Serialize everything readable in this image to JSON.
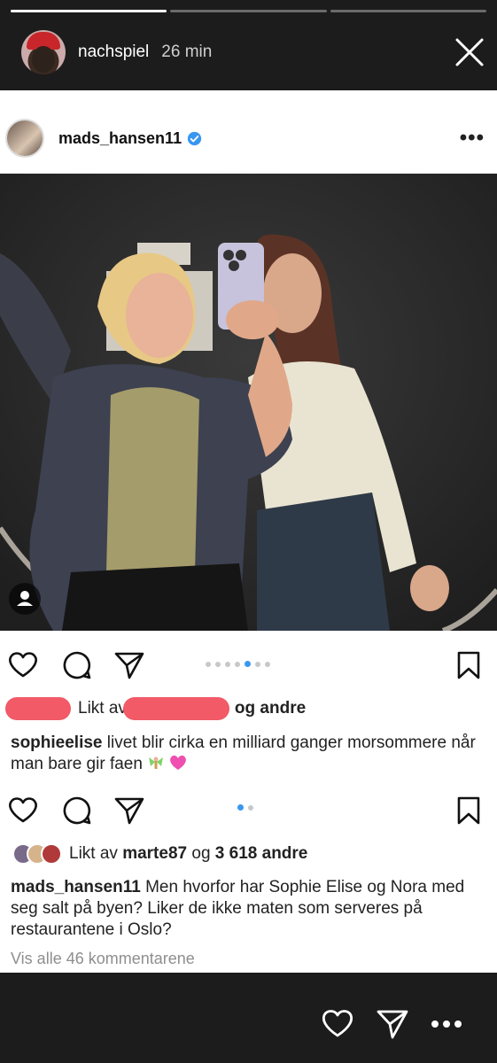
{
  "story": {
    "progress": [
      1,
      0,
      0
    ],
    "username": "nachspiel",
    "time": "26 min",
    "avatar_icon": "user-avatar-cap",
    "close_icon": "close-icon"
  },
  "post": {
    "username": "mads_hansen11",
    "verified": true,
    "more_icon": "more-horizontal-icon",
    "carousel": {
      "count": 7,
      "active_index": 4
    },
    "liked_by_prefix": "Likt av",
    "liked_by_suffix": "og andre",
    "caption_user": "sophieelise",
    "caption_text": "livet blir cirka en milliard ganger morsommere når man bare gir faen"
  },
  "outer_post": {
    "carousel": {
      "count": 2,
      "active_index": 0
    },
    "liked_by_prefix": "Likt av",
    "liked_by_user": "marte87",
    "liked_by_mid": "og",
    "liked_by_count": "3 618 andre",
    "caption_user": "mads_hansen11",
    "caption_text": "Men hvorfor har Sophie Elise og Nora med seg salt på byen? Liker de ikke maten som serveres på restaurantene i Oslo?",
    "view_all": "Vis alle 46 kommentarene"
  },
  "footer": {
    "icons": [
      "heart-icon",
      "send-icon",
      "more-horizontal-icon"
    ]
  },
  "colors": {
    "accent": "#3897f0",
    "redaction": "#f15a66",
    "story_bg": "#1c1c1c"
  }
}
